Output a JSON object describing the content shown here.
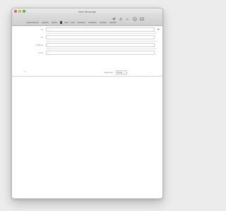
{
  "window": {
    "title": "New Message"
  },
  "toolbar": {
    "buttons": [
      {
        "name": "send",
        "icon": "paper-plane-icon"
      },
      {
        "name": "attach",
        "icon": "paperclip-icon"
      },
      {
        "name": "format",
        "icon": "text-format-icon"
      },
      {
        "name": "emoji",
        "icon": "smiley-icon"
      },
      {
        "name": "photo",
        "icon": "photo-icon"
      }
    ]
  },
  "fields": [
    {
      "label": "To:",
      "value": ""
    },
    {
      "label": "Cc:",
      "value": ""
    },
    {
      "label": "Subject:",
      "value": ""
    }
  ],
  "from": {
    "label": "From:",
    "signature_label": "Signature:",
    "signature_value": "None"
  },
  "body": {
    "text": ""
  }
}
